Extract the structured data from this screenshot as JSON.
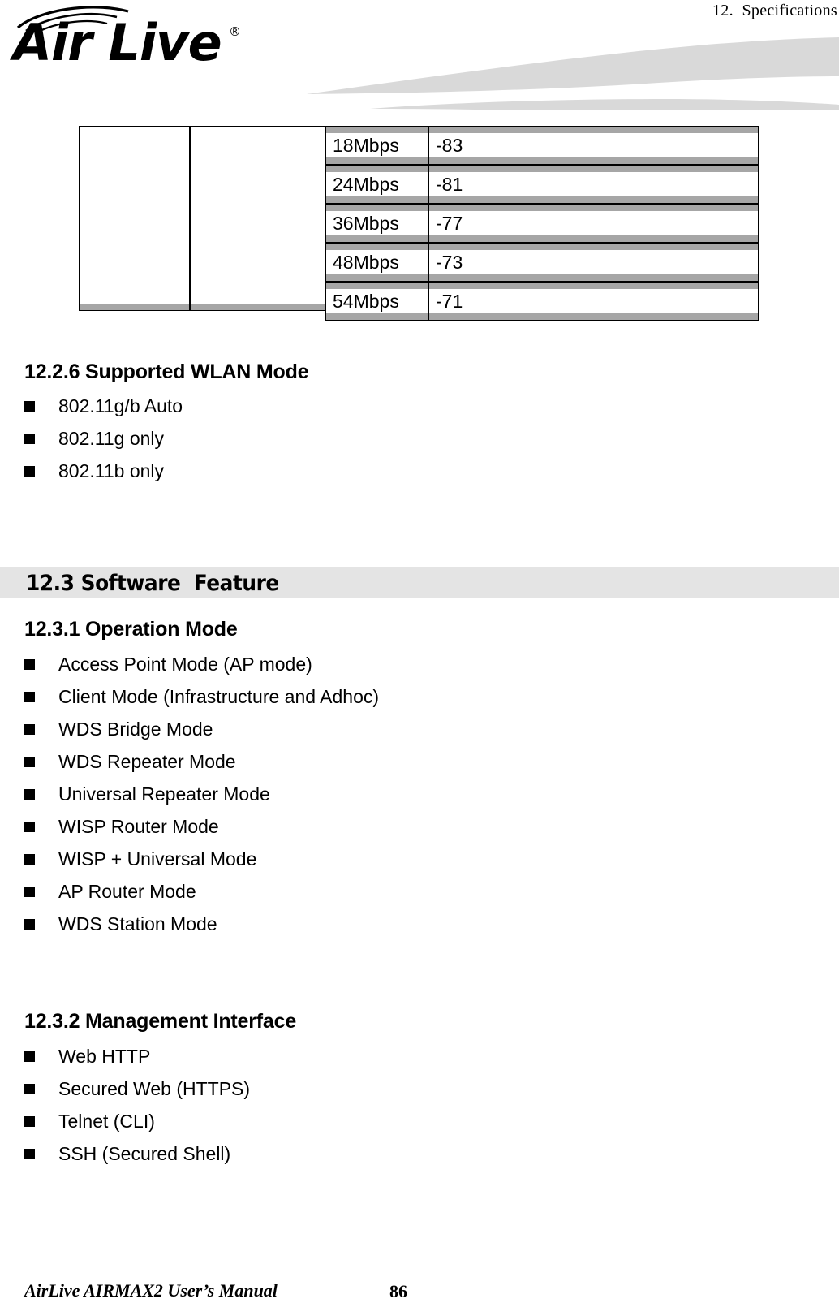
{
  "header": {
    "chapter": "12.  Specifications",
    "logo_text": "Air Live",
    "logo_registered": "®",
    "logo_arcs_icon": "wireless-signal-arcs"
  },
  "table": {
    "columns": [
      "",
      "",
      "rate",
      "sensitivity"
    ],
    "rows": [
      {
        "rate": "18Mbps",
        "sensitivity": "-83"
      },
      {
        "rate": "24Mbps",
        "sensitivity": "-81"
      },
      {
        "rate": "36Mbps",
        "sensitivity": "-77"
      },
      {
        "rate": "48Mbps",
        "sensitivity": "-73"
      },
      {
        "rate": "54Mbps",
        "sensitivity": "-71"
      }
    ]
  },
  "sections": {
    "wlan_mode": {
      "heading": "12.2.6 Supported WLAN Mode",
      "items": [
        "802.11g/b Auto",
        "802.11g only",
        "802.11b only"
      ]
    },
    "software_feature": {
      "heading": "12.3 Software  Feature"
    },
    "operation_mode": {
      "heading": "12.3.1 Operation Mode",
      "items": [
        "Access Point Mode (AP mode)",
        "Client Mode (Infrastructure and Adhoc)",
        "WDS Bridge Mode",
        "WDS Repeater Mode",
        "Universal Repeater Mode",
        "WISP Router Mode",
        "WISP + Universal Mode",
        "AP Router Mode",
        "WDS Station Mode"
      ]
    },
    "management_interface": {
      "heading": "12.3.2 Management Interface",
      "items": [
        "Web HTTP",
        "Secured Web (HTTPS)",
        "Telnet (CLI)",
        "SSH (Secured Shell)"
      ]
    }
  },
  "footer": {
    "manual_title": "AirLive AIRMAX2 User’s Manual",
    "page_number": "86"
  },
  "colors": {
    "band_gray": "#e4e4e4",
    "table_emboss_gray": "#a6a6a6",
    "swoosh_gray": "#d9d9d9",
    "text": "#000000"
  }
}
